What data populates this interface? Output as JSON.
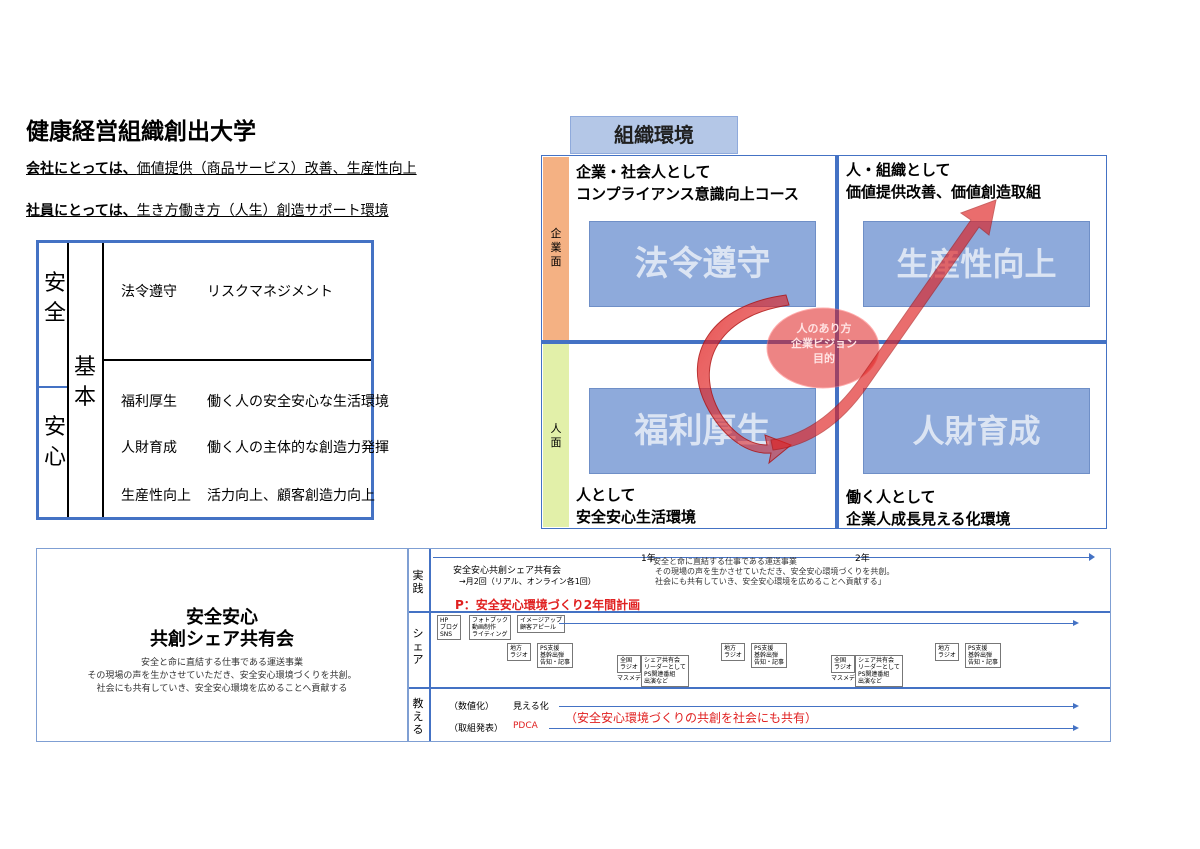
{
  "header": {
    "title": "健康経営組織創出大学",
    "line1_lead": "会社にとっては、",
    "line1_rest": "価値提供（商品サービス）改善、生産性向上",
    "line2_lead": "社員にとっては、",
    "line2_rest": "生き方働き方（人生）創造サポート環境"
  },
  "safety_table": {
    "col_safety": "安全",
    "col_security": "安心",
    "col_basic": "基本",
    "rows": [
      {
        "item": "法令遵守",
        "desc": "リスクマネジメント"
      },
      {
        "item": "福利厚生",
        "desc": "働く人の安全安心な生活環境"
      },
      {
        "item": "人財育成",
        "desc": "働く人の主体的な創造力発揮"
      },
      {
        "item": "生産性向上",
        "desc": "活力向上、顧客創造力向上"
      }
    ]
  },
  "org": {
    "title": "組織環境",
    "side_company": "企業面",
    "side_people": "人面",
    "q_tl_caption_1": "企業・社会人として",
    "q_tl_caption_2": "コンプライアンス意識向上コース",
    "q_tl_box": "法令遵守",
    "q_tr_caption_1": "人・組織として",
    "q_tr_caption_2": "価値提供改善、価値創造取組",
    "q_tr_box": "生産性向上",
    "q_bl_box": "福利厚生",
    "q_bl_caption_1": "人として",
    "q_bl_caption_2": "安全安心生活環境",
    "q_br_box": "人財育成",
    "q_br_caption_1": "働く人として",
    "q_br_caption_2": "企業人成長見える化環境",
    "center_1": "人のあり方",
    "center_2": "企業ビジョン",
    "center_3": "目的",
    "colors": {
      "accent": "#4472c4",
      "box": "#8eaadb",
      "arrow": "#e02020"
    }
  },
  "bottom": {
    "left_title_1": "安全安心",
    "left_title_2": "共創シェア共有会",
    "left_desc_1": "安全と命に直結する仕事である運送事業",
    "left_desc_2": "その現場の声を生かさせていただき、安全安心環境づくりを共創。",
    "left_desc_3": "社会にも共有していき、安全安心環境を広めることへ貢献する",
    "row1_label": "実践",
    "row2_label": "シェア",
    "row3_label": "教える",
    "year1": "1年",
    "year2": "2年",
    "practice_title": "安全安心共創シェア共有会",
    "practice_sub": "→月2回（リアル、オンライン各1回）",
    "practice_quote_1": "「安全と命に直結する仕事である運送事業",
    "practice_quote_2": "その現場の声を生かさせていただき、安全安心環境づくりを共創。",
    "practice_quote_3": "社会にも共有していき、安全安心環境を広めることへ貢献する」",
    "practice_plan": "P：安全安心環境づくり2年間計画",
    "share_box1": "HP\nブログ\nSNS",
    "share_box2": "フォトブック\n動画制作\nライティング",
    "share_box3": "イメージアップ\n顧客アピール",
    "share_radio": "地方\nラジオ",
    "share_ps": "PS支援\n基幹出弾\n告知・記事",
    "share_national": "全国\nラジオ",
    "share_national_sub": "マスメディア",
    "share_talk": "シェア共有会\nリーダーとして\nPS関連番組\n出演など",
    "teach_row1_a": "（数値化）",
    "teach_row1_b": "見える化",
    "teach_row2_a": "（取組発表）",
    "teach_row2_b": "PDCA",
    "teach_note": "（安全安心環境づくりの共創を社会にも共有）"
  }
}
